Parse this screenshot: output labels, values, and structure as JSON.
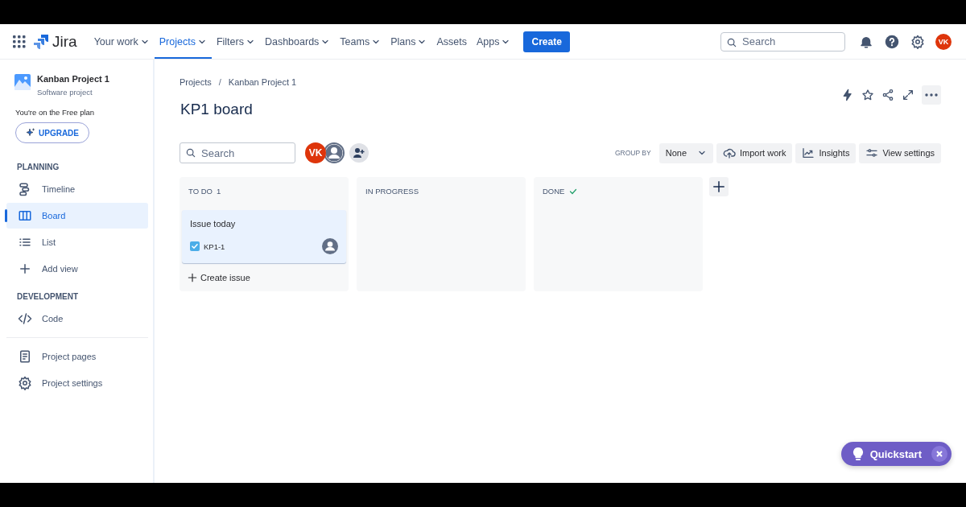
{
  "nav": {
    "items": [
      {
        "label": "Your work",
        "dropdown": true,
        "selected": false
      },
      {
        "label": "Projects",
        "dropdown": true,
        "selected": true
      },
      {
        "label": "Filters",
        "dropdown": true,
        "selected": false
      },
      {
        "label": "Dashboards",
        "dropdown": true,
        "selected": false
      },
      {
        "label": "Teams",
        "dropdown": true,
        "selected": false
      },
      {
        "label": "Plans",
        "dropdown": true,
        "selected": false
      },
      {
        "label": "Assets",
        "dropdown": false,
        "selected": false
      },
      {
        "label": "Apps",
        "dropdown": true,
        "selected": false
      }
    ],
    "product": "Jira",
    "create": "Create",
    "search_placeholder": "Search",
    "avatar": "VK"
  },
  "sidebar": {
    "project_name": "Kanban Project 1",
    "project_type": "Software project",
    "plan": "You're on the Free plan",
    "upgrade": "UPGRADE",
    "sections": [
      {
        "heading": "PLANNING",
        "items": [
          {
            "label": "Timeline",
            "kind": "timeline",
            "selected": false
          },
          {
            "label": "Board",
            "kind": "board",
            "selected": true
          },
          {
            "label": "List",
            "kind": "list",
            "selected": false
          },
          {
            "label": "Add view",
            "kind": "add",
            "selected": false
          }
        ]
      },
      {
        "heading": "DEVELOPMENT",
        "items": [
          {
            "label": "Code",
            "kind": "code",
            "selected": false
          }
        ]
      }
    ],
    "footer_items": [
      {
        "label": "Project pages",
        "kind": "pages",
        "selected": false
      },
      {
        "label": "Project settings",
        "kind": "settings",
        "selected": false
      }
    ]
  },
  "breadcrumbs": [
    "Projects",
    "Kanban Project 1"
  ],
  "breadcrumb_separator": "/",
  "title": "KP1 board",
  "toolbar": {
    "search_placeholder": "Search",
    "avatars": [
      {
        "kind": "initials",
        "initials": "VK"
      },
      {
        "kind": "unassigned"
      }
    ],
    "group_by_label": "GROUP BY",
    "group_by_value": "None",
    "buttons": [
      {
        "label": "Import work",
        "kind": "import"
      },
      {
        "label": "Insights",
        "kind": "insights"
      },
      {
        "label": "View settings",
        "kind": "settings"
      }
    ]
  },
  "columns": [
    {
      "title": "TO DO",
      "count": "1",
      "done": false,
      "cards": [
        {
          "title": "Issue today",
          "key": "KP1-1"
        }
      ],
      "create_label": "Create issue"
    },
    {
      "title": "IN PROGRESS",
      "done": false
    },
    {
      "title": "DONE",
      "done": true
    }
  ],
  "quickstart": {
    "label": "Quickstart"
  }
}
